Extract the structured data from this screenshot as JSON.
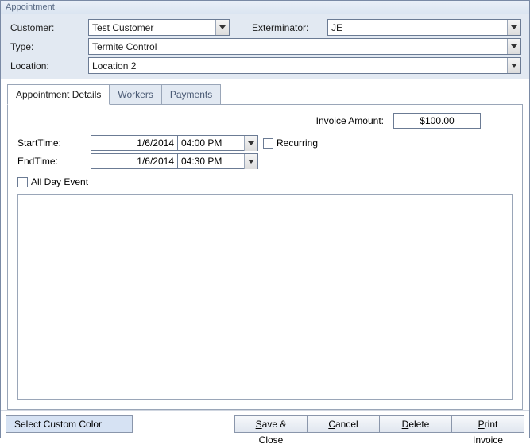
{
  "window": {
    "title": "Appointment"
  },
  "header": {
    "customer_label": "Customer:",
    "customer_value": "Test Customer",
    "exterminator_label": "Exterminator:",
    "exterminator_value": "JE",
    "type_label": "Type:",
    "type_value": "Termite Control",
    "location_label": "Location:",
    "location_value": "Location 2"
  },
  "tabs": {
    "details": "Appointment Details",
    "workers": "Workers",
    "payments": "Payments",
    "active": "details"
  },
  "details": {
    "invoice_label": "Invoice Amount:",
    "invoice_value": "$100.00",
    "start_label": "StartTime:",
    "start_date": "1/6/2014",
    "start_time": "04:00 PM",
    "end_label": "EndTime:",
    "end_date": "1/6/2014",
    "end_time": "04:30 PM",
    "recurring_label": "Recurring",
    "allday_label": "All Day Event",
    "notes": ""
  },
  "buttons": {
    "custom_color": "Select Custom Color",
    "save": "Save & Close",
    "cancel": "Cancel",
    "delete": "Delete",
    "print": "Print Invoice"
  }
}
